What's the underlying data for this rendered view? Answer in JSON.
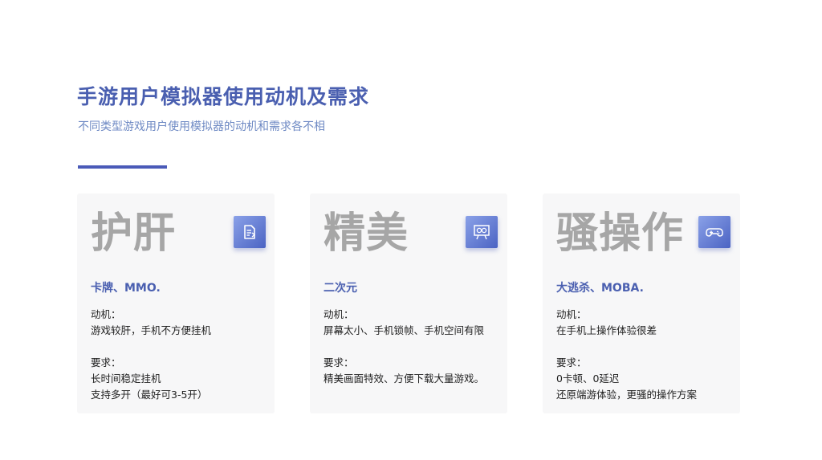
{
  "title": "手游用户模拟器使用动机及需求",
  "subtitle": "不同类型游戏用户使用模拟器的动机和需求各不相",
  "accent_color": "#4a5ab8",
  "cards": [
    {
      "big": "护肝",
      "icon": "document-icon",
      "tag": "卡牌、MMO.",
      "motive_label": "动机：",
      "motive": [
        "游戏较肝，手机不方便挂机"
      ],
      "need_label": "要求：",
      "needs": [
        "长时间稳定挂机",
        "支持多开（最好可3-5开）"
      ]
    },
    {
      "big": "精美",
      "icon": "presentation-gear-icon",
      "tag": "二次元",
      "motive_label": "动机：",
      "motive": [
        "屏幕太小、手机锁帧、手机空间有限"
      ],
      "need_label": "要求：",
      "needs": [
        "精美画面特效、方便下载大量游戏。"
      ]
    },
    {
      "big": "骚操作",
      "icon": "gamepad-icon",
      "tag": "大逃杀、MOBA.",
      "motive_label": "动机：",
      "motive": [
        "在手机上操作体验很差"
      ],
      "need_label": "要求：",
      "needs": [
        "0卡顿、0延迟",
        "还原端游体验，更骚的操作方案"
      ]
    }
  ]
}
